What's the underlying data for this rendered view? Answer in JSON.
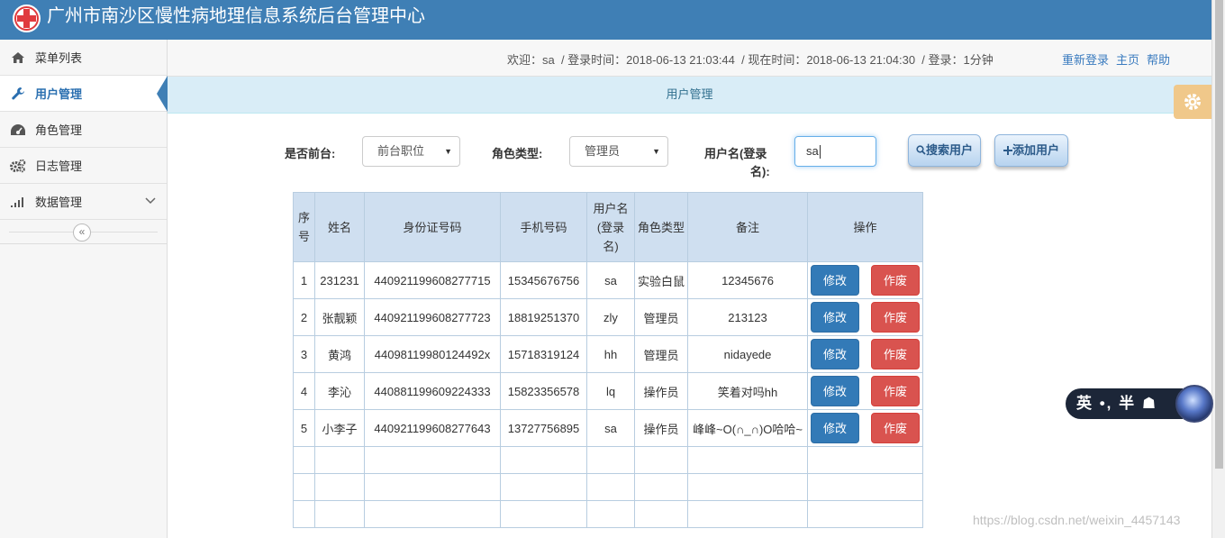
{
  "app": {
    "title": "广州市南沙区慢性病地理信息系统后台管理中心"
  },
  "sidebar": {
    "items": [
      {
        "label": "菜单列表",
        "icon": "home-icon"
      },
      {
        "label": "用户管理",
        "icon": "wrench-icon",
        "active": true
      },
      {
        "label": "角色管理",
        "icon": "dashboard-icon"
      },
      {
        "label": "日志管理",
        "icon": "cogs-icon"
      },
      {
        "label": "数据管理",
        "icon": "signal-icon",
        "has_submenu": true
      }
    ],
    "collapse_glyph": "«"
  },
  "status": {
    "text": "欢迎：sa  / 登录时间：2018-06-13 21:03:44  / 现在时间：2018-06-13 21:04:30  / 登录：1分钟",
    "links": [
      "重新登录",
      "主页",
      "帮助"
    ]
  },
  "panel": {
    "title": "用户管理"
  },
  "filters": {
    "front_label": "是否前台:",
    "front_value": "前台职位",
    "role_label": "角色类型:",
    "role_value": "管理员",
    "username_label_1": "用户名(登录",
    "username_label_2": "名):",
    "username_value": "sa",
    "search_button": "搜索用户",
    "add_button": "添加用户"
  },
  "table": {
    "headers": [
      "序号",
      "姓名",
      "身份证号码",
      "手机号码",
      "用户名(登录名)",
      "角色类型",
      "备注",
      "操作"
    ],
    "rows": [
      {
        "no": "1",
        "name": "231231",
        "id_card": "440921199608277715",
        "phone": "15345676756",
        "username": "sa",
        "role": "实验白鼠",
        "remark": "12345676"
      },
      {
        "no": "2",
        "name": "张靓颖",
        "id_card": "440921199608277723",
        "phone": "18819251370",
        "username": "zly",
        "role": "管理员",
        "remark": "213123"
      },
      {
        "no": "3",
        "name": "黄鸿",
        "id_card": "44098119980124492x",
        "phone": "15718319124",
        "username": "hh",
        "role": "管理员",
        "remark": "nidayede"
      },
      {
        "no": "4",
        "name": "李沁",
        "id_card": "440881199609224333",
        "phone": "15823356578",
        "username": "lq",
        "role": "操作员",
        "remark": "笑着对吗hh"
      },
      {
        "no": "5",
        "name": "小李子",
        "id_card": "440921199608277643",
        "phone": "13727756895",
        "username": "sa",
        "role": "操作员",
        "remark": "峰峰~O(∩_∩)O哈哈~"
      }
    ],
    "edit_label": "修改",
    "delete_label": "作废"
  },
  "ime": {
    "text": "英 •, 半 ☗"
  },
  "watermark": "https://blog.csdn.net/weixin_4457143",
  "colors": {
    "topbar": "#3f7fb5",
    "panel_head": "#d9edf7",
    "edit": "#337ab7",
    "delete": "#d9534f",
    "link": "#3a7bbf"
  }
}
